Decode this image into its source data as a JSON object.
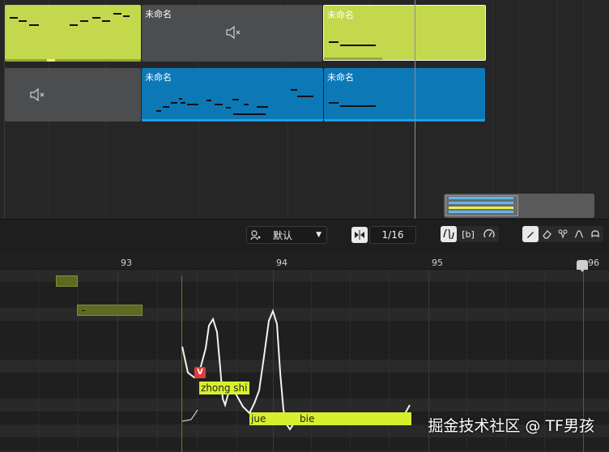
{
  "arrangement": {
    "clips": [
      {
        "title": ""
      },
      {
        "title": "未命名"
      },
      {
        "title": "未命名"
      },
      {
        "title": ""
      },
      {
        "title": "未命名"
      },
      {
        "title": "未命名"
      }
    ]
  },
  "toolbar": {
    "preset_label": "默认",
    "quantize_label": "1/16",
    "bracket_label": "[b]"
  },
  "ruler": {
    "bars": [
      "93",
      "94",
      "95",
      "96"
    ]
  },
  "lyrics": [
    "zhong shi",
    "jue",
    "bie"
  ],
  "pitch_marker_label": "V",
  "watermark": "掘金技术社区 @ TF男孩",
  "colors": {
    "note_lime": "#c3d84c",
    "clip_blue": "#0d78b6",
    "lyric_yellow": "#d8ef2e",
    "muted_gray": "#4c4d4f"
  }
}
